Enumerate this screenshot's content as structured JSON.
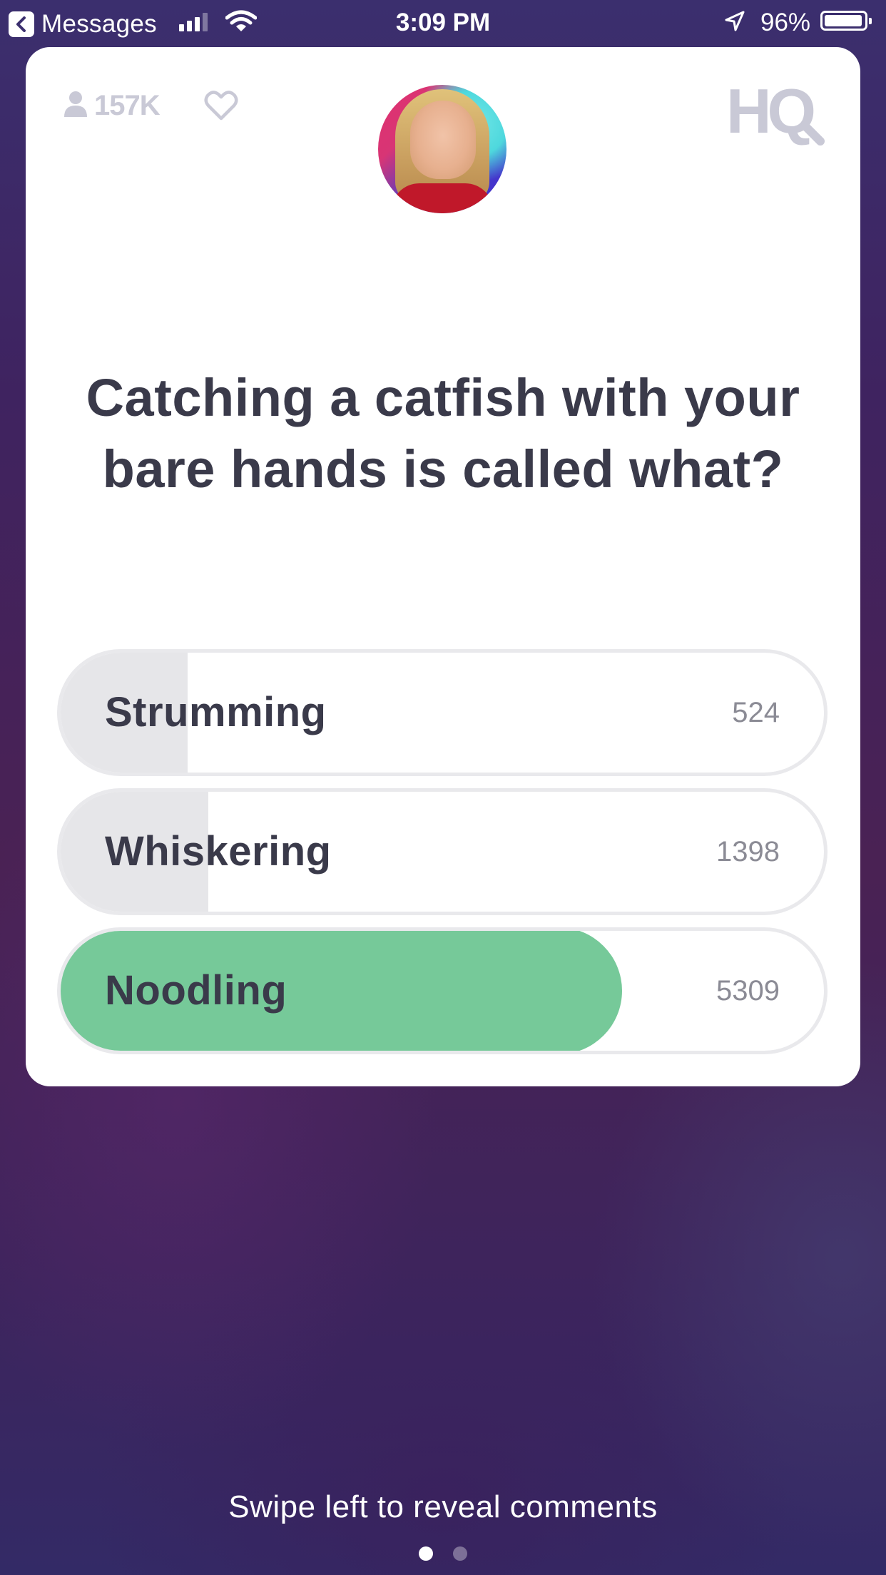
{
  "status_bar": {
    "back_app_label": "Messages",
    "time": "3:09 PM",
    "battery_percent_text": "96%",
    "battery_level": 0.96
  },
  "header": {
    "viewer_count": "157K",
    "logo_text": "HQ"
  },
  "question": {
    "text": "Catching a catfish with your bare hands is called what?"
  },
  "answers": [
    {
      "label": "Strumming",
      "votes": "524",
      "fill_fraction": 0.166,
      "correct": false
    },
    {
      "label": "Whiskering",
      "votes": "1398",
      "fill_fraction": 0.193,
      "correct": false
    },
    {
      "label": "Noodling",
      "votes": "5309",
      "fill_fraction": 0.74,
      "correct": true
    }
  ],
  "footer": {
    "swipe_hint": "Swipe left to reveal comments",
    "page_index": 0,
    "page_count": 2
  },
  "colors": {
    "correct_fill": "#76c999",
    "neutral_fill": "#e6e6e9",
    "text_dark": "#3a3a4a",
    "muted": "#c9c9d6"
  }
}
